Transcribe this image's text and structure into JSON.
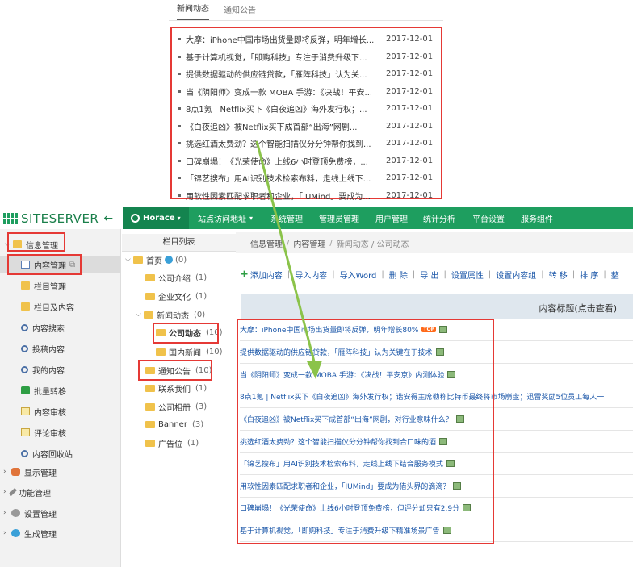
{
  "news_widget": {
    "tabs": [
      {
        "label": "新闻动态"
      },
      {
        "label": "通知公告"
      }
    ],
    "items": [
      {
        "title": "大摩：iPhone中国市场出货量即将反弹，明年增长...",
        "date": "2017-12-01"
      },
      {
        "title": "基于计算机视觉，「即购科技」专注于消费升级下...",
        "date": "2017-12-01"
      },
      {
        "title": "提供数据驱动的供应链贷款，「雁阵科技」认为关...",
        "date": "2017-12-01"
      },
      {
        "title": "当《阴阳师》变成一款 MOBA 手游：《决战！平安...",
        "date": "2017-12-01"
      },
      {
        "title": "8点1氪 | Netflix买下《白夜追凶》海外发行权；...",
        "date": "2017-12-01"
      },
      {
        "title": "《白夜追凶》被Netflix买下成首部“出海”网剧...",
        "date": "2017-12-01"
      },
      {
        "title": "挑选红酒太费劲？这个智能扫描仪分分钟帮你找到...",
        "date": "2017-12-01"
      },
      {
        "title": "口碑崩塌！《光荣使命》上线6小时登顶免费榜，...",
        "date": "2017-12-01"
      },
      {
        "title": "「锦艺搜布」用AI识别技术检索布料，走线上线下...",
        "date": "2017-12-01"
      },
      {
        "title": "用软性因素匹配求职者和企业，「IUMind」要成为...",
        "date": "2017-12-01"
      }
    ]
  },
  "topbar": {
    "logo": "SITESERVER",
    "back_icon": "arrow-left-icon",
    "site_name": "Horace",
    "nav": [
      "站点访问地址",
      "系统管理",
      "管理员管理",
      "用户管理",
      "统计分析",
      "平台设置",
      "服务组件"
    ]
  },
  "sidebar": {
    "section_info": "信息管理",
    "items": [
      {
        "label": "内容管理",
        "icon": "page-icon"
      },
      {
        "label": "栏目管理",
        "icon": "folder-icon"
      },
      {
        "label": "栏目及内容",
        "icon": "folder-icon"
      },
      {
        "label": "内容搜索",
        "icon": "search-icon"
      },
      {
        "label": "投稿内容",
        "icon": "search-icon"
      },
      {
        "label": "我的内容",
        "icon": "search-icon"
      },
      {
        "label": "批量转移",
        "icon": "transfer-icon"
      },
      {
        "label": "内容审核",
        "icon": "doc-icon"
      },
      {
        "label": "评论审核",
        "icon": "doc-icon"
      },
      {
        "label": "内容回收站",
        "icon": "recycle-icon"
      }
    ],
    "sections": [
      {
        "label": "显示管理",
        "icon": "puzzle-icon"
      },
      {
        "label": "功能管理",
        "icon": "wrench-icon"
      },
      {
        "label": "设置管理",
        "icon": "gear-icon"
      },
      {
        "label": "生成管理",
        "icon": "globe-icon"
      }
    ]
  },
  "tree": {
    "title": "栏目列表",
    "nodes": [
      {
        "label": "首页",
        "count": "(0)"
      },
      {
        "label": "公司介绍",
        "count": "(1)"
      },
      {
        "label": "企业文化",
        "count": "(1)"
      },
      {
        "label": "新闻动态",
        "count": "(0)"
      },
      {
        "label": "公司动态",
        "count": "(10)"
      },
      {
        "label": "国内新闻",
        "count": "(10)"
      },
      {
        "label": "通知公告",
        "count": "(10)"
      },
      {
        "label": "联系我们",
        "count": "(1)"
      },
      {
        "label": "公司相册",
        "count": "(3)"
      },
      {
        "label": "Banner",
        "count": "(3)"
      },
      {
        "label": "广告位",
        "count": "(1)"
      }
    ]
  },
  "main": {
    "breadcrumb": [
      "信息管理",
      "内容管理",
      "新闻动态 / 公司动态"
    ],
    "toolbar": [
      "添加内容",
      "导入内容",
      "导入Word",
      "删 除",
      "导 出",
      "设置属性",
      "设置内容组",
      "转 移",
      "排 序",
      "整"
    ],
    "column_header": "内容标题(点击查看)",
    "top_badge": "TOP",
    "rows": [
      "大摩：iPhone中国市场出货量即将反弹，明年增长80%",
      "提供数据驱动的供应链贷款，「雁阵科技」认为关键在于技术",
      "当《阴阳师》变成一款 MOBA 手游：《决战！平安京》内测体验",
      "8点1氪 | Netflix买下《白夜追凶》海外发行权；谐安得主席勒称比特币最终将市场崩盘；迅雷奖励5位员工每人一",
      "《白夜追凶》被Netflix买下成首部“出海”网剧，对行业意味什么？",
      "挑选红酒太费劲？这个智能扫描仪分分钟帮你找到合口味的酒",
      "「锦艺搜布」用AI识别技术检索布料，走线上线下结合服务模式",
      "用软性因素匹配求职者和企业，「IUMind」要成为猎头界的滴滴？",
      "口碑崩塌！《光荣使命》上线6小时登顶免费榜，但评分却只有2.9分",
      "基于计算机视觉，「即购科技」专注于消费升级下精准场景广告"
    ]
  },
  "colors": {
    "brand_green": "#1e9e5f",
    "highlight_red": "#e53935",
    "link_blue": "#1a56a8",
    "arrow_green": "#8bc34a"
  }
}
